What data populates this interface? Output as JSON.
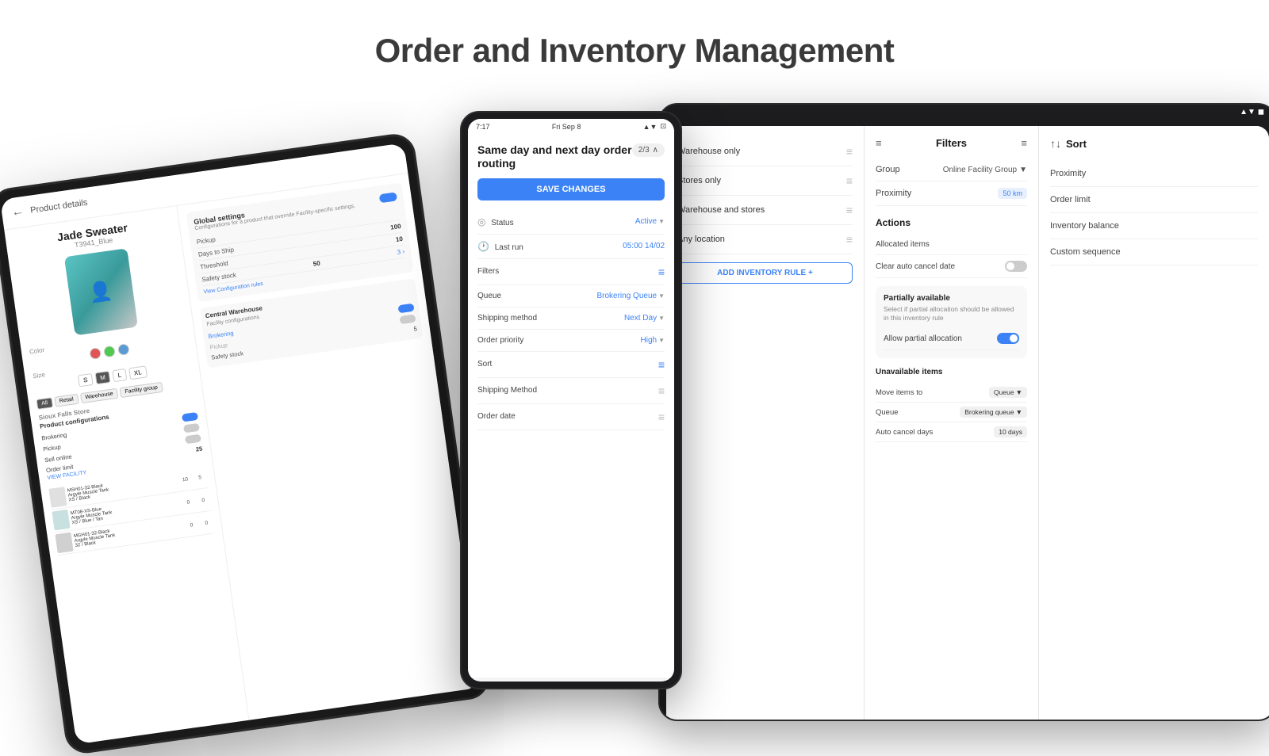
{
  "page": {
    "title": "Order and Inventory Management"
  },
  "left_tablet": {
    "product_header": "Product details",
    "product_name": "Jade Sweater",
    "product_sku": "T3941_Blue",
    "colors": [
      "#e05555",
      "#4eca4e",
      "#5b9bd5"
    ],
    "sizes": [
      "S",
      "M",
      "L",
      "S"
    ],
    "color_label": "Color",
    "size_label": "Size",
    "facility_tabs": [
      "All",
      "Retail",
      "Warehouse",
      "Facility group"
    ],
    "sioux_falls": "Sioux Falls Store",
    "product_configs_title": "Product configurations",
    "facility_configs_title": "Facility configurations",
    "rows": [
      {
        "name": "Brokering",
        "toggle": "on",
        "val": "Brokering"
      },
      {
        "name": "Pickup",
        "toggle": "off",
        "val": "Pickup"
      },
      {
        "name": "Sell online",
        "toggle": "off",
        "val": ""
      },
      {
        "name": "Order limit",
        "toggle": "off",
        "val": ""
      }
    ],
    "global_settings_title": "Global settings",
    "global_settings_desc": "Configurations for a product that override Facility-specific settings.",
    "pickup_label": "Pickup",
    "days_label": "Days to Ship",
    "days_val": "100",
    "threshold_label": "Threshold",
    "threshold_val": "10",
    "safety_label": "Safety stock",
    "safety_val": "50",
    "view_config_label": "View Configuration rules",
    "central_wh": "Central Warehouse",
    "facility_config_sub": "Facility configurations",
    "prod_config_sub": "Product configurations",
    "brokering_label": "Brokering",
    "pickup2_label": "Pickup",
    "safety_label2": "Safety stock",
    "view_facility_link": "VIEW FACILITY"
  },
  "center_tablet": {
    "status_time": "7:17",
    "status_date": "Fri Sep 8",
    "routing_title": "Same day and next day order routing",
    "counter": "2/3",
    "save_btn": "SAVE CHANGES",
    "settings": [
      {
        "icon": "filter",
        "label": "Filters",
        "value": ""
      },
      {
        "icon": "queue",
        "label": "Queue",
        "value": "Brokering Queue"
      },
      {
        "icon": "ship",
        "label": "Shipping method",
        "value": "Next Day"
      },
      {
        "icon": "priority",
        "label": "Order priority",
        "value": "High"
      },
      {
        "icon": "sort",
        "label": "Sort",
        "value": ""
      },
      {
        "icon": "",
        "label": "Shipping Method",
        "value": ""
      },
      {
        "icon": "",
        "label": "Order date",
        "value": ""
      }
    ],
    "status_label": "Status",
    "status_val": "Active",
    "last_run_label": "Last run",
    "last_run_val": "05:00 14/02"
  },
  "right_tablet": {
    "status_icons": "▲▼ ◼",
    "inventory_rules": [
      {
        "label": "Warehouse only"
      },
      {
        "label": "Stores only"
      },
      {
        "label": "Warehouse and stores"
      },
      {
        "label": "Any location"
      }
    ],
    "add_rule_btn": "ADD INVENTORY RULE +",
    "filters_title": "Filters",
    "group_label": "Group",
    "group_val": "Online Facility Group",
    "proximity_label": "Proximity",
    "proximity_val": "50 km",
    "actions_title": "Actions",
    "allocated_label": "Allocated items",
    "clear_cancel_label": "Clear auto cancel date",
    "partial_title": "Partially available",
    "partial_desc": "Select if partial allocation should be allowed in this inventory rule",
    "allow_partial_label": "Allow partial allocation",
    "unavail_title": "Unavailable items",
    "move_items_label": "Move items to",
    "move_items_val": "Queue",
    "queue_label": "Queue",
    "queue_val": "Brokering queue",
    "auto_cancel_label": "Auto cancel days",
    "auto_cancel_val": "10 days",
    "sort_title": "Sort",
    "sort_options": [
      {
        "label": "Proximity"
      },
      {
        "label": "Order limit"
      },
      {
        "label": "Inventory balance"
      },
      {
        "label": "Custom sequence"
      }
    ]
  }
}
